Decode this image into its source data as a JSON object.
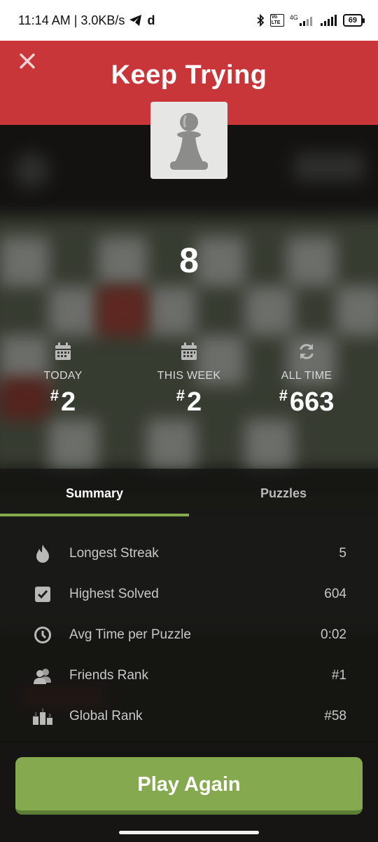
{
  "status_bar": {
    "time_speed": "11:14 AM | 3.0KB/s",
    "network": "4G",
    "volte": "Vo LTE",
    "battery": "69"
  },
  "header": {
    "title": "Keep Trying"
  },
  "result": {
    "score": "8"
  },
  "leaderboard": [
    {
      "label": "TODAY",
      "rank": "2",
      "icon": "calendar-icon"
    },
    {
      "label": "THIS WEEK",
      "rank": "2",
      "icon": "calendar-icon"
    },
    {
      "label": "ALL TIME",
      "rank": "663",
      "icon": "refresh-icon"
    }
  ],
  "rank_prefix": "#",
  "tabs": [
    {
      "label": "Summary",
      "active": true
    },
    {
      "label": "Puzzles",
      "active": false
    }
  ],
  "summary": [
    {
      "label": "Longest Streak",
      "value": "5",
      "icon": "flame-icon"
    },
    {
      "label": "Highest Solved",
      "value": "604",
      "icon": "checkbox-icon"
    },
    {
      "label": "Avg Time per Puzzle",
      "value": "0:02",
      "icon": "clock-icon"
    },
    {
      "label": "Friends Rank",
      "value": "#1",
      "icon": "friends-icon"
    },
    {
      "label": "Global Rank",
      "value": "#58",
      "icon": "podium-icon"
    }
  ],
  "play_again": "Play Again",
  "colors": {
    "header_red": "#c9363a",
    "accent_green": "#85a94e",
    "background": "#161513"
  }
}
